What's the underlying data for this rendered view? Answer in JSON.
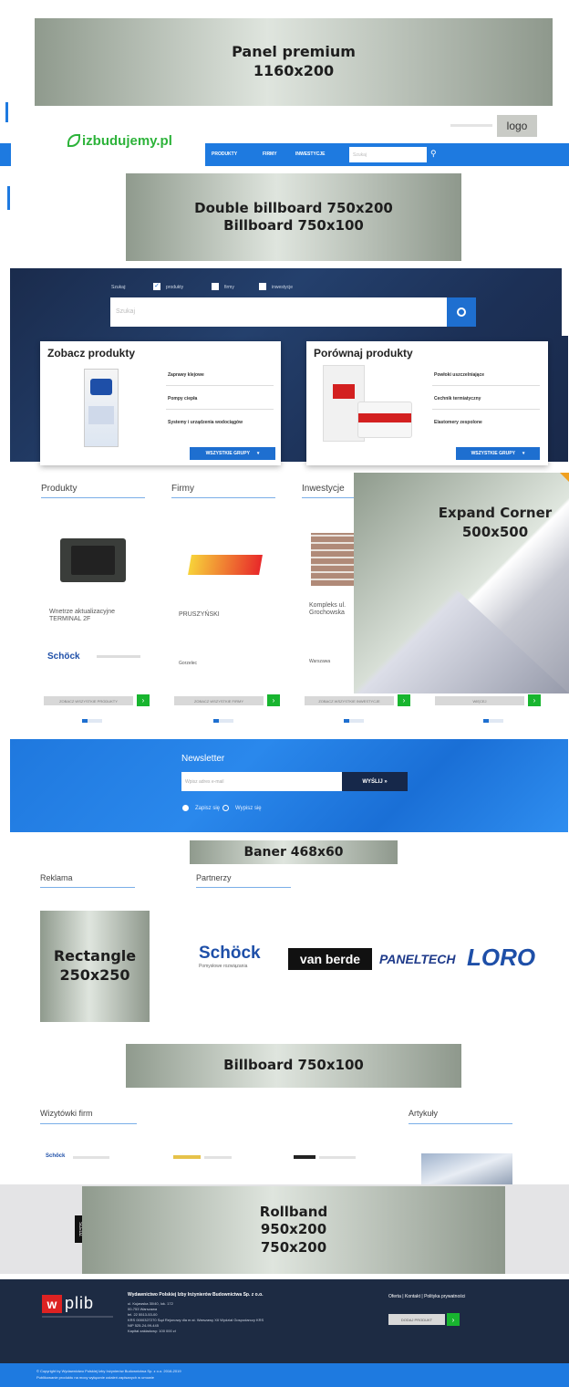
{
  "ads": {
    "panel_premium": [
      "Panel premium",
      "1160x200"
    ],
    "double_billboard": [
      "Double billboard 750x200",
      "Billboard 750x100"
    ],
    "expand_corner": [
      "Expand Corner",
      "500x500"
    ],
    "baner": [
      "Baner 468x60"
    ],
    "rectangle": [
      "Rectangle",
      "250x250"
    ],
    "billboard": [
      "Billboard  750x100"
    ],
    "rollband": [
      "Rollband",
      "950x200",
      "750x200"
    ]
  },
  "header": {
    "site_logo": "izbudujemy.pl",
    "partner_logo": "logo",
    "nav": [
      "PRODUKTY",
      "FIRMY",
      "INWESTYCJE"
    ],
    "search_placeholder": "Szukaj"
  },
  "hero": {
    "filter_label": "Szukaj:",
    "filters": [
      "produkty",
      "firmy",
      "inwestycje"
    ],
    "search_placeholder": "Szukaj",
    "card_left": {
      "title": "Zobacz produkty",
      "items": [
        "Zaprawy klejowe",
        "Pompy ciepła",
        "Systemy i urządzenia wodociągów"
      ],
      "button": "WSZYSTKIE GRUPY"
    },
    "card_right": {
      "title": "Porównaj produkty",
      "items": [
        "Powłoki uszczelniające",
        "Cechnik termiatyczny",
        "Elastomery zespolone"
      ],
      "button": "WSZYSTKIE GRUPY"
    }
  },
  "listing": {
    "tabs": [
      "Produkty",
      "Firmy",
      "Inwestycje"
    ],
    "items": [
      {
        "name": "Wnetrze aktualizacyjne TERMINAL 2F",
        "company": "Schöck",
        "button": "ZOBACZ WSZYSTKIE PRODUKTY"
      },
      {
        "name": "PRUSZYŃSKI",
        "company": "Gorzelec",
        "button": "ZOBACZ WSZYSTKIE FIRMY"
      },
      {
        "name": "Kompleks ul. Grochowska",
        "company": "Warszawa",
        "button": "ZOBACZ WSZYSTKIE INWESTYCJE"
      },
      {
        "name": "",
        "company": "",
        "button": "WIĘCEJ"
      }
    ]
  },
  "newsletter": {
    "title": "Newsletter",
    "placeholder": "Wpisz adres e-mail",
    "button": "WYŚLIJ »",
    "options": [
      "Zapisz się",
      "Wypisz się"
    ]
  },
  "partners": {
    "reklama": "Reklama",
    "title": "Partnerzy",
    "logos": [
      "Schöck",
      "van berde",
      "PANELTECH",
      "LORO"
    ],
    "schock_sub": "Pomysłowe rozwiązania"
  },
  "bottom": {
    "wizytowki": "Wizytówki firm",
    "artykuly": "Artykuły",
    "side_tab": "ŚLEDŹ"
  },
  "footer": {
    "logo": "plib",
    "company": "Wydawnictwo Polskiej Izby Inżynierów Budownictwa Sp. z o.o.",
    "address": [
      "ul. Kujawska 30/40, lok. 172",
      "00-753 Warszawa",
      "tel. 22 5513-53-00",
      "KRS 0000327270 Sąd Rejonowy dla m.st. Warszawy XII Wydział Gospodarczy KRS",
      "NIP 525-24-99-445",
      "Kapitał zakładowy: 100 000 zł"
    ],
    "links": [
      "Oferta",
      "Kontakt",
      "Polityka prywatności"
    ],
    "footer_button": "DODAJ PRODUKT",
    "copyright": "© Copyright by Wydawnictwo Polskiej Izby Inżynierów Budownictwa Sp. z o.o. 2016-2019",
    "copyright2": "Publikowanie produktu na mocy wyłącznie ustaleń zapisanych w umowie"
  },
  "colors": {
    "blue": "#1e7ae0",
    "navy": "#1a2b4c",
    "green": "#18b52f",
    "footer": "#1d2b43"
  }
}
